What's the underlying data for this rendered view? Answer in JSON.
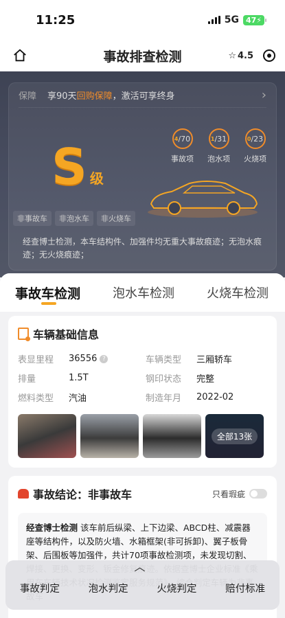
{
  "status_bar": {
    "time": "11:25",
    "network": "5G",
    "battery": "47"
  },
  "nav": {
    "title": "事故排查检测",
    "rating": "4.5"
  },
  "hero": {
    "guarantee_label": "保障",
    "guarantee_pre": "享90天",
    "guarantee_highlight": "回购保障",
    "guarantee_post": "，激活可享终身",
    "grade_letter": "S",
    "grade_unit": "级",
    "checks": [
      {
        "num": "4",
        "total": "/70",
        "label": "事故项"
      },
      {
        "num": "1",
        "total": "/31",
        "label": "泡水项"
      },
      {
        "num": "0",
        "total": "/23",
        "label": "火烧项"
      }
    ],
    "tags": [
      "非事故车",
      "非泡水车",
      "非火烧车"
    ],
    "description": "经查博士检测，本车结构件、加强件均无重大事故痕迹；无泡水痕迹；无火烧痕迹；"
  },
  "tabs": [
    "事故车检测",
    "泡水车检测",
    "火烧车检测"
  ],
  "basic_info": {
    "title": "车辆基础信息",
    "rows": [
      {
        "k1": "表显里程",
        "v1": "36556",
        "k2": "车辆类型",
        "v2": "三厢轿车"
      },
      {
        "k1": "排量",
        "v1": "1.5T",
        "k2": "钢印状态",
        "v2": "完整"
      },
      {
        "k1": "燃料类型",
        "v1": "汽油",
        "k2": "制造年月",
        "v2": "2022-02"
      }
    ],
    "all_photos": "全部13张"
  },
  "conclusion": {
    "title": "事故结论：非事故车",
    "toggle_label": "只看瑕疵",
    "text_bold": "经查博士检测",
    "text": " 该车前后纵梁、上下边梁、ABCD柱、减震器座等结构件，以及防火墙、水箱框架(非可拆卸)、翼子板骨架、后围板等加强件，共计70项事故检测项，未发现切割、焊接、更换、变形、钣金修复痕迹。依据查博士企业标准《乘用车车辆技术状况检测鉴定服务规范》，综合判定车辆为非事故车"
  },
  "bottom_bar": {
    "items": [
      "事故判定",
      "泡水判定",
      "火烧判定",
      "赔付标准"
    ]
  }
}
